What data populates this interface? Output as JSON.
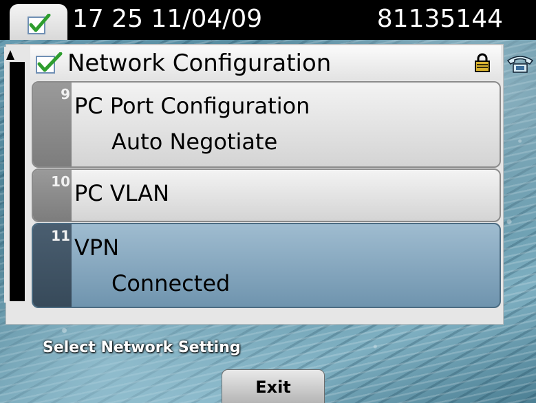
{
  "status_bar": {
    "time_date": "17 25 11/04/09",
    "phone_number": "81135144"
  },
  "list": {
    "title": "Network Configuration",
    "items": [
      {
        "number": "9",
        "label": "PC Port Configuration",
        "value": "Auto Negotiate",
        "selected": false
      },
      {
        "number": "10",
        "label": "PC VLAN",
        "value": "",
        "selected": false
      },
      {
        "number": "11",
        "label": "VPN",
        "value": "Connected",
        "selected": true
      }
    ]
  },
  "prompt": "Select Network Setting",
  "softkeys": {
    "exit_label": "Exit"
  },
  "icons": {
    "status_tab": "check-icon",
    "title": "check-icon",
    "lock": "lock-icon",
    "line": "phone-icon"
  },
  "colors": {
    "status_bar_bg": "#000000",
    "selected_row": "#7e9fb6",
    "row_bg": "#e0e0e0",
    "check_green": "#2e9d2e"
  }
}
